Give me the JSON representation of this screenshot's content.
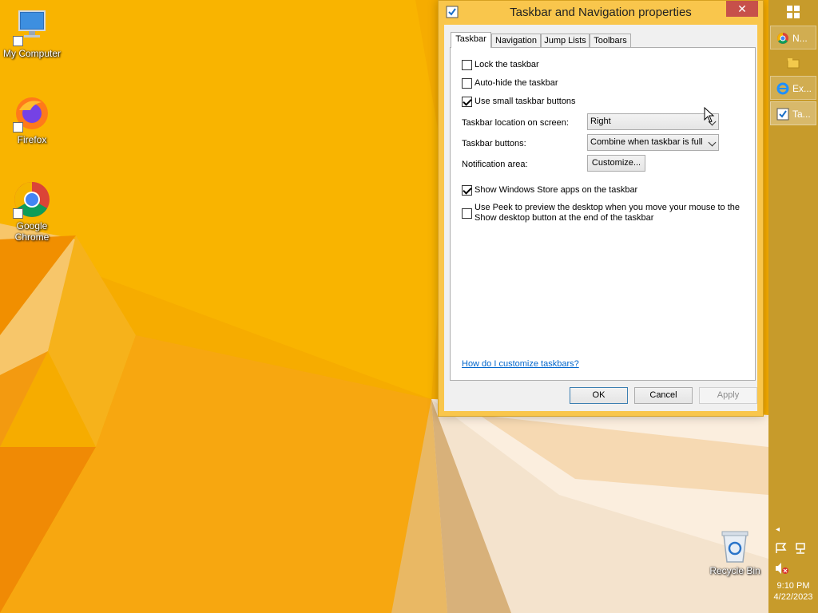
{
  "desktop": {
    "icons": [
      {
        "label": "My Computer"
      },
      {
        "label": "Firefox"
      },
      {
        "label": "Google Chrome"
      },
      {
        "label": "Recycle Bin"
      }
    ]
  },
  "dialog": {
    "title": "Taskbar and Navigation properties",
    "close_glyph": "✕",
    "tabs": [
      "Taskbar",
      "Navigation",
      "Jump Lists",
      "Toolbars"
    ],
    "active_tab": "Taskbar",
    "checkboxes": [
      {
        "label": "Lock the taskbar",
        "checked": false
      },
      {
        "label": "Auto-hide the taskbar",
        "checked": false
      },
      {
        "label": "Use small taskbar buttons",
        "checked": true
      },
      {
        "label": "Show Windows Store apps on the taskbar",
        "checked": true
      },
      {
        "label": "Use Peek to preview the desktop when you move your mouse to the",
        "label2": "Show desktop button at the end of the taskbar",
        "checked": false
      }
    ],
    "location_label": "Taskbar location on screen:",
    "location_value": "Right",
    "buttons_label": "Taskbar buttons:",
    "buttons_value": "Combine when taskbar is full",
    "notification_label": "Notification area:",
    "customize_label": "Customize...",
    "help_link": "How do I customize taskbars?",
    "ok_label": "OK",
    "cancel_label": "Cancel",
    "apply_label": "Apply"
  },
  "taskbar": {
    "items": [
      {
        "label": "N...",
        "icon": "chrome-icon"
      },
      {
        "label": "",
        "icon": "file-explorer-icon"
      },
      {
        "label": "Ex...",
        "icon": "internet-explorer-icon"
      },
      {
        "label": "Ta...",
        "icon": "taskbar-properties-icon"
      }
    ],
    "time": "9:10 PM",
    "date": "4/22/2023"
  },
  "colors": {
    "wallpaper": "#f4a900",
    "dialog_frame": "#f9c64c",
    "close_button": "#c7504a",
    "taskbar": "#c79b2b",
    "link": "#0066cc"
  }
}
